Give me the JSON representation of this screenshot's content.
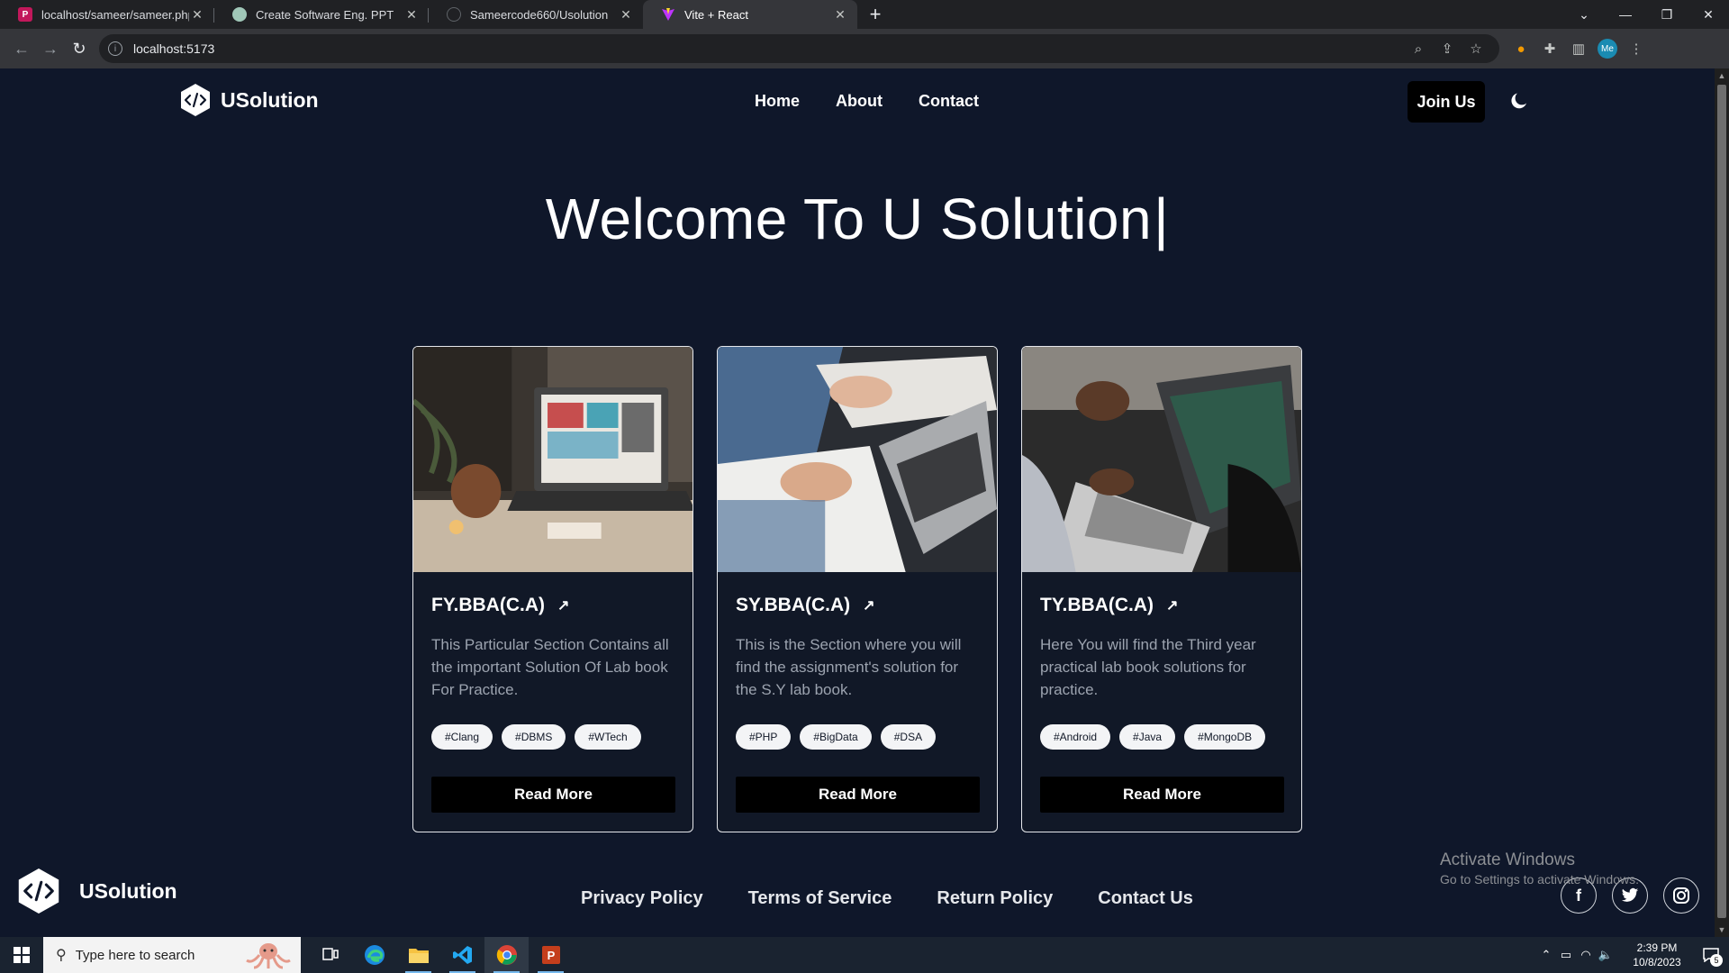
{
  "browser": {
    "tabs": [
      {
        "title": "localhost/sameer/sameer.php",
        "icon": "php-favicon-icon",
        "color": "#c2185b"
      },
      {
        "title": "Create Software Eng. PPT",
        "icon": "chatgpt-favicon-icon",
        "color": "#a0c7b8"
      },
      {
        "title": "Sameercode660/Usolution",
        "icon": "github-favicon-icon",
        "color": "#202124"
      },
      {
        "title": "Vite + React",
        "icon": "vite-favicon-icon",
        "color": "#bd34fe"
      }
    ],
    "active_tab": 3,
    "url": "localhost:5173",
    "profile_label": "Me"
  },
  "site": {
    "brand": "USolution",
    "nav": {
      "home": "Home",
      "about": "About",
      "contact": "Contact"
    },
    "join_label": "Join Us",
    "hero_title": "Welcome To U Solution",
    "hero_cursor": "|",
    "cards": [
      {
        "title": "FY.BBA(C.A)",
        "arrow": "↗",
        "description": "This Particular Section Contains all the important Solution Of Lab book For Practice.",
        "tags": [
          "#Clang",
          "#DBMS",
          "#WTech"
        ],
        "button": "Read More"
      },
      {
        "title": "SY.BBA(C.A)",
        "arrow": "↗",
        "description": "This is the Section where you will find the assignment's solution for the S.Y lab book.",
        "tags": [
          "#PHP",
          "#BigData",
          "#DSA"
        ],
        "button": "Read More"
      },
      {
        "title": "TY.BBA(C.A)",
        "arrow": "↗",
        "description": "Here You will find the Third year practical lab book solutions for practice.",
        "tags": [
          "#Android",
          "#Java",
          "#MongoDB"
        ],
        "button": "Read More"
      }
    ],
    "footer": {
      "brand": "USolution",
      "links": [
        "Privacy Policy",
        "Terms of Service",
        "Return Policy",
        "Contact Us"
      ],
      "social": {
        "facebook": "f",
        "twitter": "🐦",
        "instagram": "◎"
      }
    }
  },
  "watermark": {
    "line1": "Activate Windows",
    "line2": "Go to Settings to activate Windows."
  },
  "taskbar": {
    "search_placeholder": "Type here to search",
    "time": "2:39 PM",
    "date": "10/8/2023",
    "notification_count": "5"
  },
  "colors": {
    "page_bg": "#0f172a",
    "card_border": "#e5e7eb",
    "button_bg": "#000000",
    "desc_text": "#9ca3af"
  }
}
